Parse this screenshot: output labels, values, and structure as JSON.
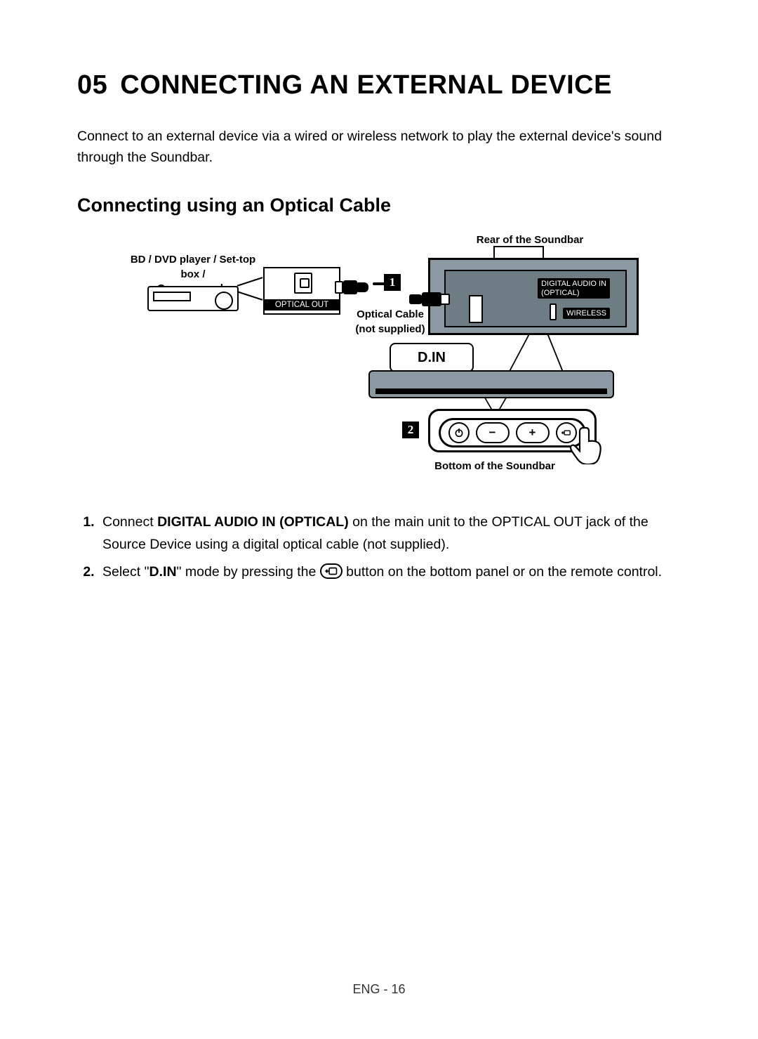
{
  "chapter": {
    "number": "05",
    "title": "CONNECTING AN EXTERNAL DEVICE"
  },
  "intro": "Connect to an external device via a wired or wireless network to play the external device's sound through the Soundbar.",
  "subheading": "Connecting using an Optical Cable",
  "diagram": {
    "source_label": "BD / DVD player / Set-top box /\nGame console",
    "optical_out": "OPTICAL OUT",
    "cable_label": "Optical Cable\n(not supplied)",
    "rear_label": "Rear of the Soundbar",
    "digital_in": "DIGITAL AUDIO IN\n(OPTICAL)",
    "wireless": "WIRELESS",
    "display_text": "D.IN",
    "bottom_label": "Bottom of the Soundbar",
    "badge1": "1",
    "badge2": "2"
  },
  "steps": {
    "s1_pre": "Connect ",
    "s1_bold": "DIGITAL AUDIO IN (OPTICAL)",
    "s1_post": " on the main unit to the OPTICAL OUT jack of the Source Device using a digital optical cable (not supplied).",
    "s2_pre": "Select \"",
    "s2_bold": "D.IN",
    "s2_mid": "\" mode by pressing the ",
    "s2_post": " button on the bottom panel or on the remote control."
  },
  "footer": "ENG - 16"
}
